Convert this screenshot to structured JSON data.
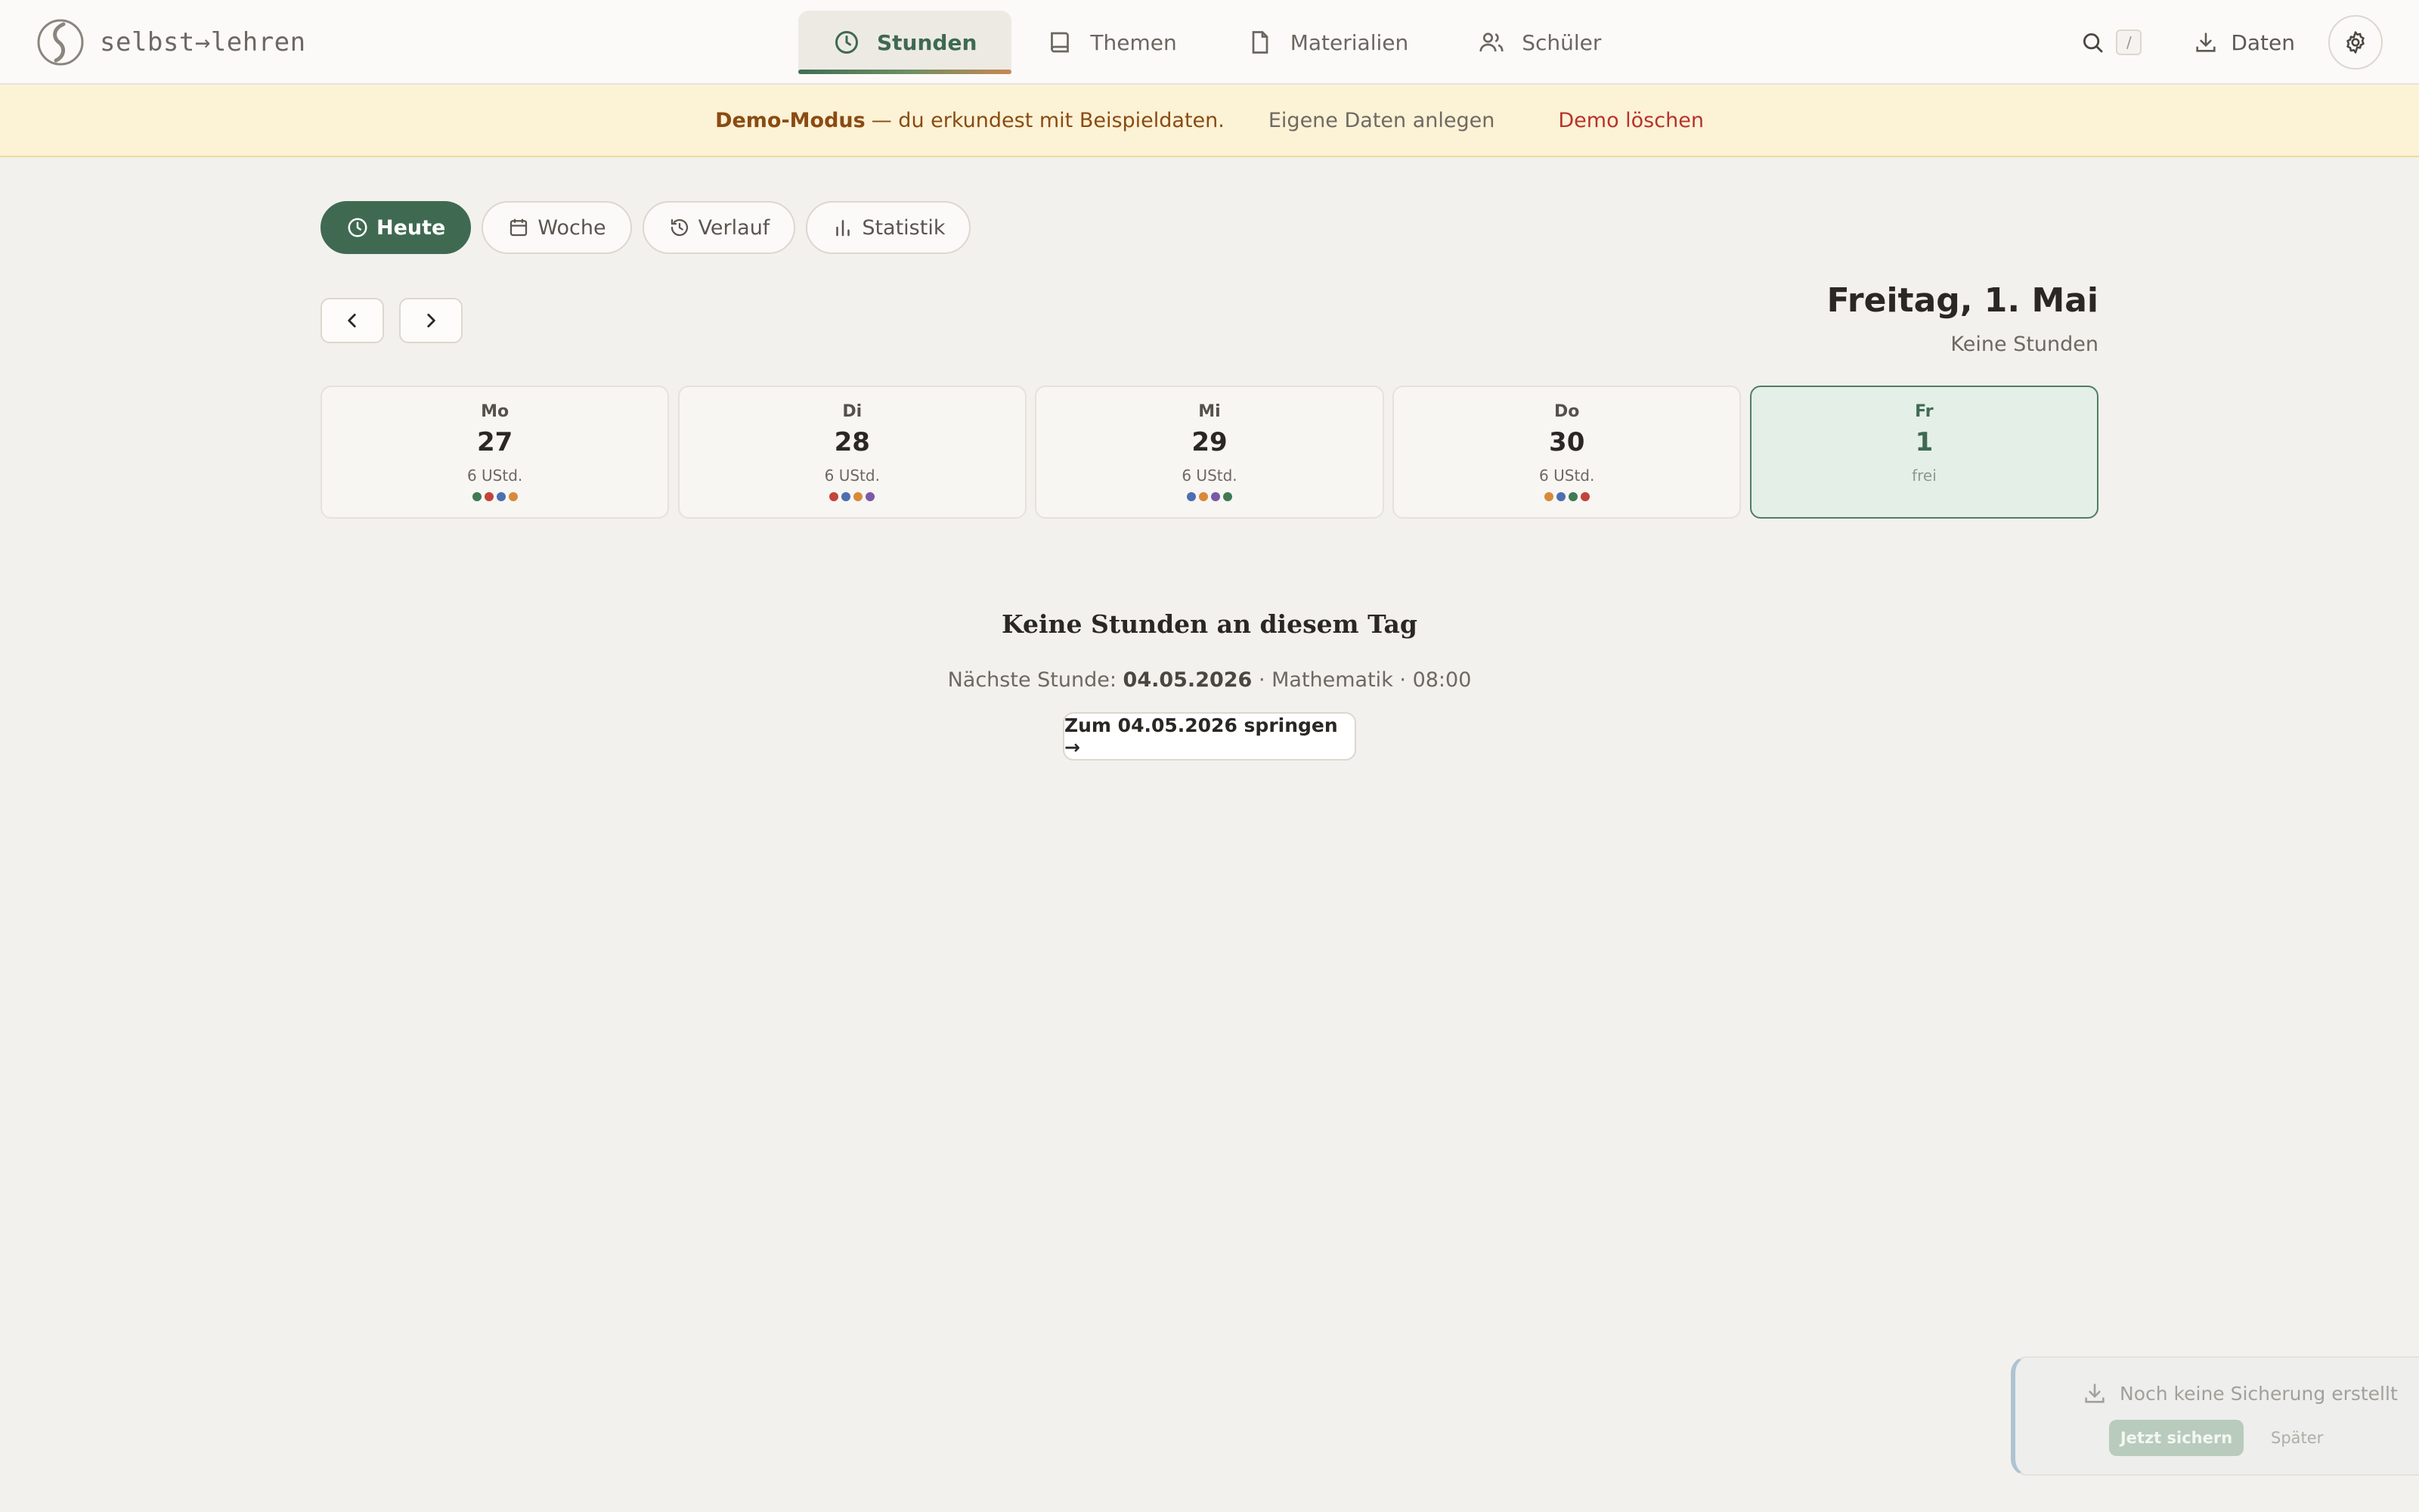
{
  "brand": {
    "name": "selbst→lehren",
    "logo_icon": "brand-logo-icon"
  },
  "nav": {
    "items": [
      {
        "label": "Stunden",
        "icon": "clock-icon",
        "active": true
      },
      {
        "label": "Themen",
        "icon": "book-icon",
        "active": false
      },
      {
        "label": "Materialien",
        "icon": "document-icon",
        "active": false
      },
      {
        "label": "Schüler",
        "icon": "users-icon",
        "active": false
      }
    ]
  },
  "top_actions": {
    "search_shortcut": "/",
    "data_label": "Daten"
  },
  "banner": {
    "strong": "Demo-Modus",
    "text": "— du erkundest mit Beispieldaten.",
    "create_own": "Eigene Daten anlegen",
    "delete_demo": "Demo löschen"
  },
  "view_tabs": [
    {
      "label": "Heute",
      "icon": "clock-icon",
      "active": true
    },
    {
      "label": "Woche",
      "icon": "calendar-icon",
      "active": false
    },
    {
      "label": "Verlauf",
      "icon": "history-icon",
      "active": false
    },
    {
      "label": "Statistik",
      "icon": "bar-chart-icon",
      "active": false
    }
  ],
  "day_header": {
    "title": "Freitag, 1. Mai",
    "subtitle": "Keine Stunden"
  },
  "week": [
    {
      "name": "Mo",
      "num": "27",
      "info": "6 UStd.",
      "dots": [
        "#3f7a55",
        "#c2443b",
        "#4c6fb0",
        "#d88a3a"
      ],
      "active": false
    },
    {
      "name": "Di",
      "num": "28",
      "info": "6 UStd.",
      "dots": [
        "#c2443b",
        "#4c6fb0",
        "#d88a3a",
        "#7b58a8"
      ],
      "active": false
    },
    {
      "name": "Mi",
      "num": "29",
      "info": "6 UStd.",
      "dots": [
        "#4c6fb0",
        "#d88a3a",
        "#7b58a8",
        "#3f7a55"
      ],
      "active": false
    },
    {
      "name": "Do",
      "num": "30",
      "info": "6 UStd.",
      "dots": [
        "#d88a3a",
        "#4c6fb0",
        "#3f7a55",
        "#c2443b"
      ],
      "active": false
    },
    {
      "name": "Fr",
      "num": "1",
      "info": "frei",
      "dots": [],
      "active": true
    }
  ],
  "empty_state": {
    "title": "Keine Stunden an diesem Tag",
    "next_prefix": "Nächste Stunde:",
    "next_date": "04.05.2026",
    "next_rest": "· Mathematik · 08:00",
    "jump_label": "Zum 04.05.2026 springen →"
  },
  "toast": {
    "message": "Noch keine Sicherung erstellt",
    "primary": "Jetzt sichern",
    "secondary": "Später"
  },
  "colors": {
    "accent": "#3f6a51",
    "banner_bg": "#fcf2d6",
    "danger": "#b8322a"
  }
}
